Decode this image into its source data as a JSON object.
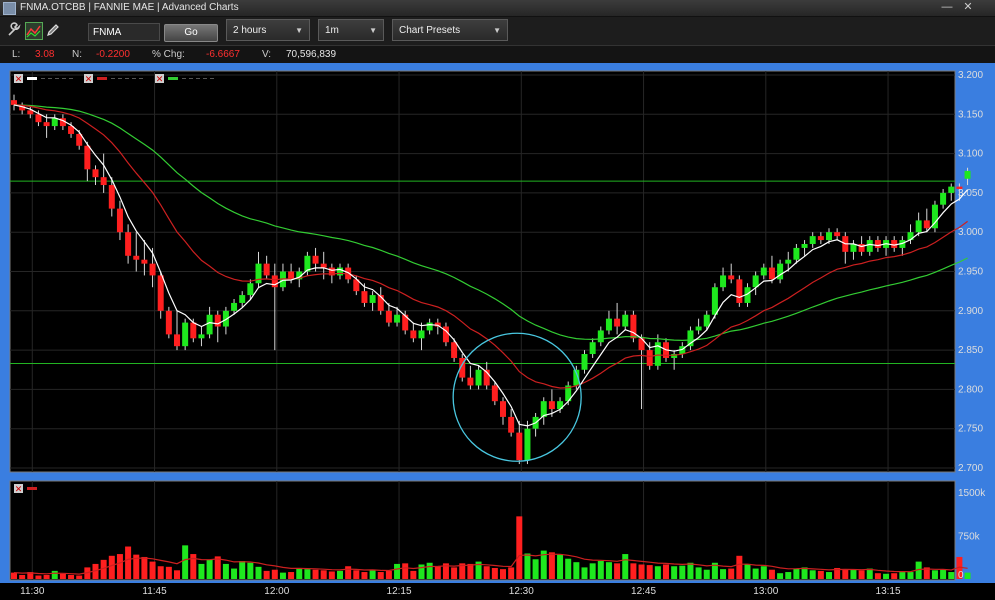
{
  "window": {
    "title": "FNMA.OTCBB | FANNIE MAE | Advanced Charts",
    "minimize_glyph": "—",
    "close_glyph": "✕"
  },
  "toolbar": {
    "tools": [
      "wrench-icon",
      "indicator-chart-icon",
      "pencil-icon"
    ],
    "symbol_value": "FNMA",
    "go_label": "Go",
    "period": "2 hours",
    "interval": "1m",
    "presets": "Chart Presets"
  },
  "quote": {
    "last_label": "L:",
    "last_value": "3.08",
    "net_label": "N:",
    "net_value": "-0.2200",
    "pct_label": "% Chg:",
    "pct_value": "-6.6667",
    "volume_label": "V:",
    "volume_value": "70,596,839"
  },
  "colors": {
    "up": "#1ee81e",
    "down": "#ff1f1f",
    "ma_fast": "#ffffff",
    "ma_mid": "#cc2020",
    "ma_slow": "#33cc33",
    "hline": "#22b422",
    "circle": "#49c7e0",
    "frame": "#3a7ee0"
  },
  "chart_data": [
    {
      "type": "candlestick",
      "interval": "1m",
      "y_ticks": [
        "3.200",
        "3.150",
        "3.100",
        "3.050",
        "3.000",
        "2.950",
        "2.900",
        "2.850",
        "2.800",
        "2.750",
        "2.700"
      ],
      "ylim": [
        2.7,
        3.2
      ],
      "x_ticks": [
        "11:30",
        "11:45",
        "12:00",
        "12:15",
        "12:30",
        "12:45",
        "13:00",
        "13:15"
      ],
      "horizontal_lines": [
        3.065,
        2.833
      ],
      "annotation": {
        "type": "circle",
        "time_index": 61,
        "price": 2.79
      },
      "ohlc": [
        [
          3.168,
          3.175,
          3.155,
          3.162
        ],
        [
          3.162,
          3.165,
          3.15,
          3.155
        ],
        [
          3.155,
          3.16,
          3.145,
          3.15
        ],
        [
          3.15,
          3.155,
          3.135,
          3.14
        ],
        [
          3.14,
          3.15,
          3.12,
          3.135
        ],
        [
          3.135,
          3.15,
          3.13,
          3.145
        ],
        [
          3.145,
          3.15,
          3.13,
          3.135
        ],
        [
          3.135,
          3.14,
          3.12,
          3.125
        ],
        [
          3.125,
          3.13,
          3.105,
          3.11
        ],
        [
          3.11,
          3.115,
          3.065,
          3.08
        ],
        [
          3.08,
          3.085,
          3.06,
          3.07
        ],
        [
          3.07,
          3.1,
          3.05,
          3.06
        ],
        [
          3.06,
          3.07,
          3.02,
          3.03
        ],
        [
          3.03,
          3.04,
          2.99,
          3.0
        ],
        [
          3.0,
          3.01,
          2.96,
          2.97
        ],
        [
          2.97,
          3.0,
          2.95,
          2.965
        ],
        [
          2.965,
          2.99,
          2.945,
          2.96
        ],
        [
          2.96,
          2.98,
          2.93,
          2.945
        ],
        [
          2.945,
          2.95,
          2.89,
          2.9
        ],
        [
          2.9,
          2.905,
          2.865,
          2.87
        ],
        [
          2.87,
          2.9,
          2.85,
          2.855
        ],
        [
          2.855,
          2.89,
          2.85,
          2.885
        ],
        [
          2.885,
          2.89,
          2.86,
          2.865
        ],
        [
          2.865,
          2.88,
          2.855,
          2.87
        ],
        [
          2.87,
          2.905,
          2.865,
          2.895
        ],
        [
          2.895,
          2.9,
          2.86,
          2.88
        ],
        [
          2.88,
          2.905,
          2.87,
          2.9
        ],
        [
          2.9,
          2.915,
          2.895,
          2.91
        ],
        [
          2.91,
          2.925,
          2.905,
          2.92
        ],
        [
          2.92,
          2.94,
          2.915,
          2.935
        ],
        [
          2.935,
          2.975,
          2.93,
          2.96
        ],
        [
          2.96,
          2.97,
          2.94,
          2.945
        ],
        [
          2.945,
          2.96,
          2.85,
          2.93
        ],
        [
          2.93,
          2.96,
          2.925,
          2.95
        ],
        [
          2.95,
          2.96,
          2.935,
          2.94
        ],
        [
          2.94,
          2.955,
          2.93,
          2.95
        ],
        [
          2.95,
          2.975,
          2.945,
          2.97
        ],
        [
          2.97,
          2.98,
          2.95,
          2.96
        ],
        [
          2.96,
          2.975,
          2.94,
          2.955
        ],
        [
          2.955,
          2.96,
          2.935,
          2.945
        ],
        [
          2.945,
          2.96,
          2.94,
          2.955
        ],
        [
          2.955,
          2.96,
          2.935,
          2.94
        ],
        [
          2.94,
          2.945,
          2.92,
          2.925
        ],
        [
          2.925,
          2.935,
          2.905,
          2.91
        ],
        [
          2.91,
          2.925,
          2.9,
          2.92
        ],
        [
          2.92,
          2.93,
          2.895,
          2.9
        ],
        [
          2.9,
          2.91,
          2.88,
          2.885
        ],
        [
          2.885,
          2.905,
          2.88,
          2.895
        ],
        [
          2.895,
          2.9,
          2.87,
          2.875
        ],
        [
          2.875,
          2.885,
          2.86,
          2.865
        ],
        [
          2.865,
          2.885,
          2.85,
          2.875
        ],
        [
          2.875,
          2.89,
          2.87,
          2.885
        ],
        [
          2.885,
          2.89,
          2.87,
          2.88
        ],
        [
          2.88,
          2.885,
          2.855,
          2.86
        ],
        [
          2.86,
          2.865,
          2.835,
          2.84
        ],
        [
          2.84,
          2.845,
          2.81,
          2.815
        ],
        [
          2.815,
          2.83,
          2.8,
          2.805
        ],
        [
          2.805,
          2.83,
          2.8,
          2.825
        ],
        [
          2.825,
          2.835,
          2.8,
          2.805
        ],
        [
          2.805,
          2.81,
          2.78,
          2.785
        ],
        [
          2.785,
          2.79,
          2.755,
          2.765
        ],
        [
          2.765,
          2.775,
          2.74,
          2.745
        ],
        [
          2.745,
          2.76,
          2.705,
          2.71
        ],
        [
          2.71,
          2.76,
          2.705,
          2.75
        ],
        [
          2.75,
          2.77,
          2.74,
          2.765
        ],
        [
          2.765,
          2.79,
          2.755,
          2.785
        ],
        [
          2.785,
          2.8,
          2.765,
          2.775
        ],
        [
          2.775,
          2.79,
          2.77,
          2.785
        ],
        [
          2.785,
          2.81,
          2.78,
          2.805
        ],
        [
          2.805,
          2.83,
          2.8,
          2.825
        ],
        [
          2.825,
          2.85,
          2.82,
          2.845
        ],
        [
          2.845,
          2.865,
          2.84,
          2.86
        ],
        [
          2.86,
          2.88,
          2.855,
          2.875
        ],
        [
          2.875,
          2.9,
          2.87,
          2.89
        ],
        [
          2.89,
          2.91,
          2.87,
          2.88
        ],
        [
          2.88,
          2.9,
          2.875,
          2.895
        ],
        [
          2.895,
          2.9,
          2.86,
          2.865
        ],
        [
          2.865,
          2.87,
          2.775,
          2.85
        ],
        [
          2.85,
          2.86,
          2.825,
          2.83
        ],
        [
          2.83,
          2.87,
          2.825,
          2.86
        ],
        [
          2.86,
          2.865,
          2.835,
          2.84
        ],
        [
          2.84,
          2.85,
          2.825,
          2.845
        ],
        [
          2.845,
          2.86,
          2.84,
          2.855
        ],
        [
          2.855,
          2.88,
          2.85,
          2.875
        ],
        [
          2.875,
          2.89,
          2.87,
          2.88
        ],
        [
          2.88,
          2.9,
          2.875,
          2.895
        ],
        [
          2.895,
          2.935,
          2.89,
          2.93
        ],
        [
          2.93,
          2.955,
          2.925,
          2.945
        ],
        [
          2.945,
          2.96,
          2.935,
          2.94
        ],
        [
          2.94,
          2.945,
          2.905,
          2.91
        ],
        [
          2.91,
          2.935,
          2.905,
          2.93
        ],
        [
          2.93,
          2.95,
          2.92,
          2.945
        ],
        [
          2.945,
          2.96,
          2.94,
          2.955
        ],
        [
          2.955,
          2.97,
          2.935,
          2.94
        ],
        [
          2.94,
          2.965,
          2.935,
          2.96
        ],
        [
          2.96,
          2.975,
          2.95,
          2.965
        ],
        [
          2.965,
          2.985,
          2.96,
          2.98
        ],
        [
          2.98,
          2.99,
          2.97,
          2.985
        ],
        [
          2.985,
          3.0,
          2.98,
          2.995
        ],
        [
          2.995,
          3.0,
          2.985,
          2.99
        ],
        [
          2.99,
          3.005,
          2.985,
          3.0
        ],
        [
          3.0,
          3.005,
          2.99,
          2.995
        ],
        [
          2.995,
          3.0,
          2.96,
          2.975
        ],
        [
          2.975,
          2.99,
          2.965,
          2.985
        ],
        [
          2.985,
          2.995,
          2.97,
          2.975
        ],
        [
          2.975,
          2.995,
          2.97,
          2.99
        ],
        [
          2.99,
          2.995,
          2.975,
          2.98
        ],
        [
          2.98,
          2.995,
          2.97,
          2.99
        ],
        [
          2.99,
          2.995,
          2.975,
          2.98
        ],
        [
          2.98,
          2.995,
          2.97,
          2.99
        ],
        [
          2.99,
          3.01,
          2.985,
          3.0
        ],
        [
          3.0,
          3.025,
          2.995,
          3.015
        ],
        [
          3.015,
          3.03,
          3.0,
          3.005
        ],
        [
          3.005,
          3.04,
          3.0,
          3.035
        ],
        [
          3.035,
          3.055,
          3.03,
          3.05
        ],
        [
          3.05,
          3.062,
          3.04,
          3.058
        ],
        [
          3.058,
          3.062,
          3.04,
          3.055
        ],
        [
          3.068,
          3.082,
          3.06,
          3.078
        ]
      ],
      "volume_axis": [
        "1500k",
        "750k",
        "0"
      ],
      "volume_ylim": [
        0,
        1500
      ],
      "volume": [
        110,
        70,
        120,
        60,
        70,
        140,
        90,
        70,
        60,
        200,
        260,
        330,
        400,
        430,
        560,
        420,
        380,
        300,
        220,
        210,
        150,
        580,
        430,
        260,
        330,
        390,
        260,
        180,
        310,
        280,
        210,
        140,
        160,
        110,
        120,
        180,
        170,
        160,
        150,
        130,
        140,
        220,
        150,
        120,
        160,
        120,
        140,
        260,
        270,
        140,
        250,
        280,
        220,
        270,
        200,
        270,
        260,
        300,
        220,
        190,
        170,
        200,
        1080,
        440,
        340,
        490,
        460,
        420,
        350,
        290,
        200,
        270,
        310,
        290,
        270,
        430,
        270,
        250,
        240,
        220,
        250,
        220,
        230,
        280,
        200,
        160,
        280,
        170,
        180,
        400,
        260,
        180,
        220,
        160,
        100,
        120,
        180,
        200,
        150,
        140,
        120,
        190,
        170,
        160,
        150,
        180,
        100,
        90,
        100,
        120,
        120,
        300,
        200,
        150,
        160,
        120,
        380,
        110
      ]
    }
  ]
}
